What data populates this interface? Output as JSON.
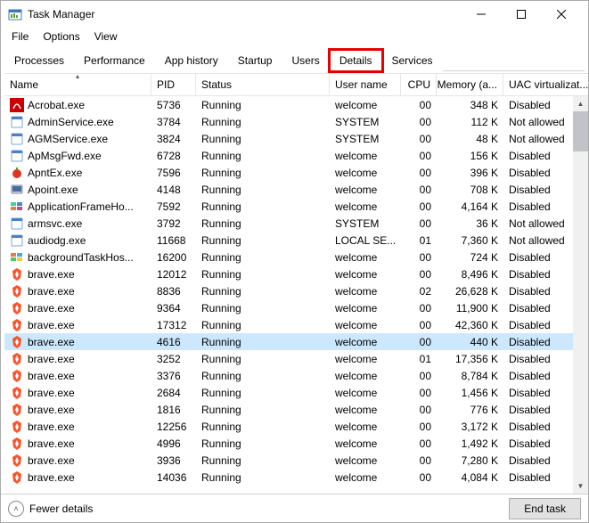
{
  "window": {
    "title": "Task Manager"
  },
  "menu": {
    "file": "File",
    "options": "Options",
    "view": "View"
  },
  "tabs": {
    "processes": "Processes",
    "performance": "Performance",
    "app_history": "App history",
    "startup": "Startup",
    "users": "Users",
    "details": "Details",
    "services": "Services"
  },
  "columns": {
    "name": "Name",
    "pid": "PID",
    "status": "Status",
    "user": "User name",
    "cpu": "CPU",
    "memory": "Memory (a...",
    "uac": "UAC virtualizat..."
  },
  "rows": [
    {
      "icon": "acrobat",
      "name": "Acrobat.exe",
      "pid": "5736",
      "status": "Running",
      "user": "welcome",
      "cpu": "00",
      "mem": "348 K",
      "uac": "Disabled",
      "sel": false
    },
    {
      "icon": "generic",
      "name": "AdminService.exe",
      "pid": "3784",
      "status": "Running",
      "user": "SYSTEM",
      "cpu": "00",
      "mem": "112 K",
      "uac": "Not allowed",
      "sel": false
    },
    {
      "icon": "generic",
      "name": "AGMService.exe",
      "pid": "3824",
      "status": "Running",
      "user": "SYSTEM",
      "cpu": "00",
      "mem": "48 K",
      "uac": "Not allowed",
      "sel": false
    },
    {
      "icon": "generic",
      "name": "ApMsgFwd.exe",
      "pid": "6728",
      "status": "Running",
      "user": "welcome",
      "cpu": "00",
      "mem": "156 K",
      "uac": "Disabled",
      "sel": false
    },
    {
      "icon": "apnt",
      "name": "ApntEx.exe",
      "pid": "7596",
      "status": "Running",
      "user": "welcome",
      "cpu": "00",
      "mem": "396 K",
      "uac": "Disabled",
      "sel": false
    },
    {
      "icon": "apoint",
      "name": "Apoint.exe",
      "pid": "4148",
      "status": "Running",
      "user": "welcome",
      "cpu": "00",
      "mem": "708 K",
      "uac": "Disabled",
      "sel": false
    },
    {
      "icon": "appframe",
      "name": "ApplicationFrameHo...",
      "pid": "7592",
      "status": "Running",
      "user": "welcome",
      "cpu": "00",
      "mem": "4,164 K",
      "uac": "Disabled",
      "sel": false
    },
    {
      "icon": "generic",
      "name": "armsvc.exe",
      "pid": "3792",
      "status": "Running",
      "user": "SYSTEM",
      "cpu": "00",
      "mem": "36 K",
      "uac": "Not allowed",
      "sel": false
    },
    {
      "icon": "generic",
      "name": "audiodg.exe",
      "pid": "11668",
      "status": "Running",
      "user": "LOCAL SE...",
      "cpu": "01",
      "mem": "7,360 K",
      "uac": "Not allowed",
      "sel": false
    },
    {
      "icon": "bgtask",
      "name": "backgroundTaskHos...",
      "pid": "16200",
      "status": "Running",
      "user": "welcome",
      "cpu": "00",
      "mem": "724 K",
      "uac": "Disabled",
      "sel": false
    },
    {
      "icon": "brave",
      "name": "brave.exe",
      "pid": "12012",
      "status": "Running",
      "user": "welcome",
      "cpu": "00",
      "mem": "8,496 K",
      "uac": "Disabled",
      "sel": false
    },
    {
      "icon": "brave",
      "name": "brave.exe",
      "pid": "8836",
      "status": "Running",
      "user": "welcome",
      "cpu": "02",
      "mem": "26,628 K",
      "uac": "Disabled",
      "sel": false
    },
    {
      "icon": "brave",
      "name": "brave.exe",
      "pid": "9364",
      "status": "Running",
      "user": "welcome",
      "cpu": "00",
      "mem": "11,900 K",
      "uac": "Disabled",
      "sel": false
    },
    {
      "icon": "brave",
      "name": "brave.exe",
      "pid": "17312",
      "status": "Running",
      "user": "welcome",
      "cpu": "00",
      "mem": "42,360 K",
      "uac": "Disabled",
      "sel": false
    },
    {
      "icon": "brave",
      "name": "brave.exe",
      "pid": "4616",
      "status": "Running",
      "user": "welcome",
      "cpu": "00",
      "mem": "440 K",
      "uac": "Disabled",
      "sel": true
    },
    {
      "icon": "brave",
      "name": "brave.exe",
      "pid": "3252",
      "status": "Running",
      "user": "welcome",
      "cpu": "01",
      "mem": "17,356 K",
      "uac": "Disabled",
      "sel": false
    },
    {
      "icon": "brave",
      "name": "brave.exe",
      "pid": "3376",
      "status": "Running",
      "user": "welcome",
      "cpu": "00",
      "mem": "8,784 K",
      "uac": "Disabled",
      "sel": false
    },
    {
      "icon": "brave",
      "name": "brave.exe",
      "pid": "2684",
      "status": "Running",
      "user": "welcome",
      "cpu": "00",
      "mem": "1,456 K",
      "uac": "Disabled",
      "sel": false
    },
    {
      "icon": "brave",
      "name": "brave.exe",
      "pid": "1816",
      "status": "Running",
      "user": "welcome",
      "cpu": "00",
      "mem": "776 K",
      "uac": "Disabled",
      "sel": false
    },
    {
      "icon": "brave",
      "name": "brave.exe",
      "pid": "12256",
      "status": "Running",
      "user": "welcome",
      "cpu": "00",
      "mem": "3,172 K",
      "uac": "Disabled",
      "sel": false
    },
    {
      "icon": "brave",
      "name": "brave.exe",
      "pid": "4996",
      "status": "Running",
      "user": "welcome",
      "cpu": "00",
      "mem": "1,492 K",
      "uac": "Disabled",
      "sel": false
    },
    {
      "icon": "brave",
      "name": "brave.exe",
      "pid": "3936",
      "status": "Running",
      "user": "welcome",
      "cpu": "00",
      "mem": "7,280 K",
      "uac": "Disabled",
      "sel": false
    },
    {
      "icon": "brave",
      "name": "brave.exe",
      "pid": "14036",
      "status": "Running",
      "user": "welcome",
      "cpu": "00",
      "mem": "4,084 K",
      "uac": "Disabled",
      "sel": false
    }
  ],
  "footer": {
    "fewer": "Fewer details",
    "end_task": "End task"
  }
}
